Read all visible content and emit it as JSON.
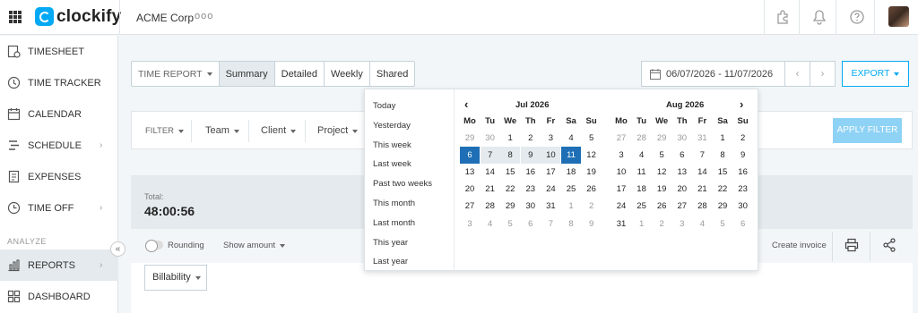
{
  "topbar": {
    "logo": "clockify",
    "workspace": "ACME Corp",
    "more": "ooo"
  },
  "sidebar": {
    "items": [
      {
        "label": "TIMESHEET",
        "icon": "timesheet-icon"
      },
      {
        "label": "TIME TRACKER",
        "icon": "clock-icon"
      },
      {
        "label": "CALENDAR",
        "icon": "calendar-icon"
      },
      {
        "label": "SCHEDULE",
        "icon": "schedule-icon",
        "chevron": true
      },
      {
        "label": "EXPENSES",
        "icon": "expenses-icon"
      },
      {
        "label": "TIME OFF",
        "icon": "time-off-icon",
        "chevron": true
      }
    ],
    "section": "ANALYZE",
    "items2": [
      {
        "label": "REPORTS",
        "icon": "reports-icon",
        "chevron": true,
        "active": true
      },
      {
        "label": "DASHBOARD",
        "icon": "dashboard-icon"
      }
    ],
    "collapse": "«"
  },
  "toolbar": {
    "report_type": "TIME REPORT",
    "tabs": [
      "Summary",
      "Detailed",
      "Weekly",
      "Shared"
    ],
    "active_tab": "Summary",
    "date_range": "06/07/2026 - 11/07/2026",
    "prev": "‹",
    "next": "›",
    "export": "EXPORT"
  },
  "filters": {
    "items": [
      "FILTER",
      "Team",
      "Client",
      "Project"
    ],
    "apply": "APPLY FILTER"
  },
  "summary": {
    "total_label": "Total:",
    "total_value": "48:00:56",
    "rounding": "Rounding",
    "show_amount": "Show amount",
    "create_invoice": "Create invoice",
    "group_by": "Billability"
  },
  "datepicker": {
    "presets": [
      "Today",
      "Yesterday",
      "This week",
      "Last week",
      "Past two weeks",
      "This month",
      "Last month",
      "This year",
      "Last year"
    ],
    "weekdays": [
      "Mo",
      "Tu",
      "We",
      "Th",
      "Fr",
      "Sa",
      "Su"
    ],
    "months": [
      {
        "title": "Jul 2026",
        "weeks": [
          [
            {
              "d": "29",
              "m": true
            },
            {
              "d": "30",
              "m": true
            },
            {
              "d": "1"
            },
            {
              "d": "2"
            },
            {
              "d": "3"
            },
            {
              "d": "4"
            },
            {
              "d": "5"
            }
          ],
          [
            {
              "d": "6",
              "s": true
            },
            {
              "d": "7",
              "r": true
            },
            {
              "d": "8",
              "r": true
            },
            {
              "d": "9",
              "r": true
            },
            {
              "d": "10",
              "r": true
            },
            {
              "d": "11",
              "s": true
            },
            {
              "d": "12"
            }
          ],
          [
            {
              "d": "13"
            },
            {
              "d": "14"
            },
            {
              "d": "15"
            },
            {
              "d": "16"
            },
            {
              "d": "17"
            },
            {
              "d": "18"
            },
            {
              "d": "19"
            }
          ],
          [
            {
              "d": "20"
            },
            {
              "d": "21"
            },
            {
              "d": "22"
            },
            {
              "d": "23"
            },
            {
              "d": "24"
            },
            {
              "d": "25"
            },
            {
              "d": "26"
            }
          ],
          [
            {
              "d": "27"
            },
            {
              "d": "28"
            },
            {
              "d": "29"
            },
            {
              "d": "30"
            },
            {
              "d": "31"
            },
            {
              "d": "1",
              "m": true
            },
            {
              "d": "2",
              "m": true
            }
          ],
          [
            {
              "d": "3",
              "m": true
            },
            {
              "d": "4",
              "m": true
            },
            {
              "d": "5",
              "m": true
            },
            {
              "d": "6",
              "m": true
            },
            {
              "d": "7",
              "m": true
            },
            {
              "d": "8",
              "m": true
            },
            {
              "d": "9",
              "m": true
            }
          ]
        ]
      },
      {
        "title": "Aug 2026",
        "weeks": [
          [
            {
              "d": "27",
              "m": true
            },
            {
              "d": "28",
              "m": true
            },
            {
              "d": "29",
              "m": true
            },
            {
              "d": "30",
              "m": true
            },
            {
              "d": "31",
              "m": true
            },
            {
              "d": "1"
            },
            {
              "d": "2"
            }
          ],
          [
            {
              "d": "3"
            },
            {
              "d": "4"
            },
            {
              "d": "5"
            },
            {
              "d": "6"
            },
            {
              "d": "7"
            },
            {
              "d": "8"
            },
            {
              "d": "9"
            }
          ],
          [
            {
              "d": "10"
            },
            {
              "d": "11"
            },
            {
              "d": "12"
            },
            {
              "d": "13"
            },
            {
              "d": "14"
            },
            {
              "d": "15"
            },
            {
              "d": "16"
            }
          ],
          [
            {
              "d": "17"
            },
            {
              "d": "18"
            },
            {
              "d": "19"
            },
            {
              "d": "20"
            },
            {
              "d": "21"
            },
            {
              "d": "22"
            },
            {
              "d": "23"
            }
          ],
          [
            {
              "d": "24"
            },
            {
              "d": "25"
            },
            {
              "d": "26"
            },
            {
              "d": "27"
            },
            {
              "d": "28"
            },
            {
              "d": "29"
            },
            {
              "d": "30"
            }
          ],
          [
            {
              "d": "31"
            },
            {
              "d": "1",
              "m": true
            },
            {
              "d": "2",
              "m": true
            },
            {
              "d": "3",
              "m": true
            },
            {
              "d": "4",
              "m": true
            },
            {
              "d": "5",
              "m": true
            },
            {
              "d": "6",
              "m": true
            }
          ]
        ]
      }
    ]
  },
  "colors": {
    "accent": "#03a9f4",
    "selected": "#1e6fb5",
    "range": "#e4eaee"
  }
}
